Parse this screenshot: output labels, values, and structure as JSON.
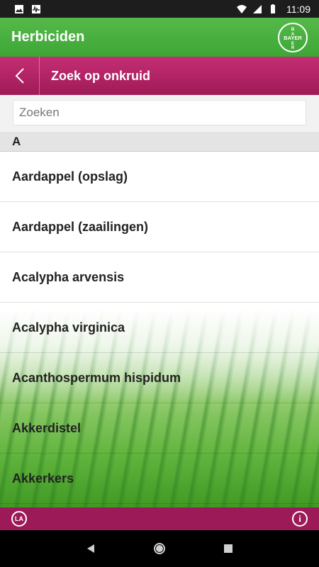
{
  "status_bar": {
    "time": "11:09",
    "icons": [
      "image-icon",
      "activity-icon",
      "wifi-icon",
      "signal-icon",
      "battery-icon"
    ]
  },
  "header": {
    "title": "Herbiciden",
    "logo": "BAYER",
    "accent_color": "#45ad3c"
  },
  "sub_header": {
    "title": "Zoek op onkruid",
    "back_icon": "chevron-left-icon",
    "accent_color": "#b3235f"
  },
  "search": {
    "placeholder": "Zoeken",
    "value": ""
  },
  "list": {
    "section_letter": "A",
    "items": [
      "Aardappel (opslag)",
      "Aardappel (zaailingen)",
      "Acalypha arvensis",
      "Acalypha virginica",
      "Acanthospermum hispidum",
      "Akkerdistel",
      "Akkerkers"
    ]
  },
  "bottom_bar": {
    "left_label": "LA",
    "right_label": "i"
  },
  "nav": {
    "buttons": [
      "back-icon",
      "home-icon",
      "recents-icon"
    ]
  }
}
